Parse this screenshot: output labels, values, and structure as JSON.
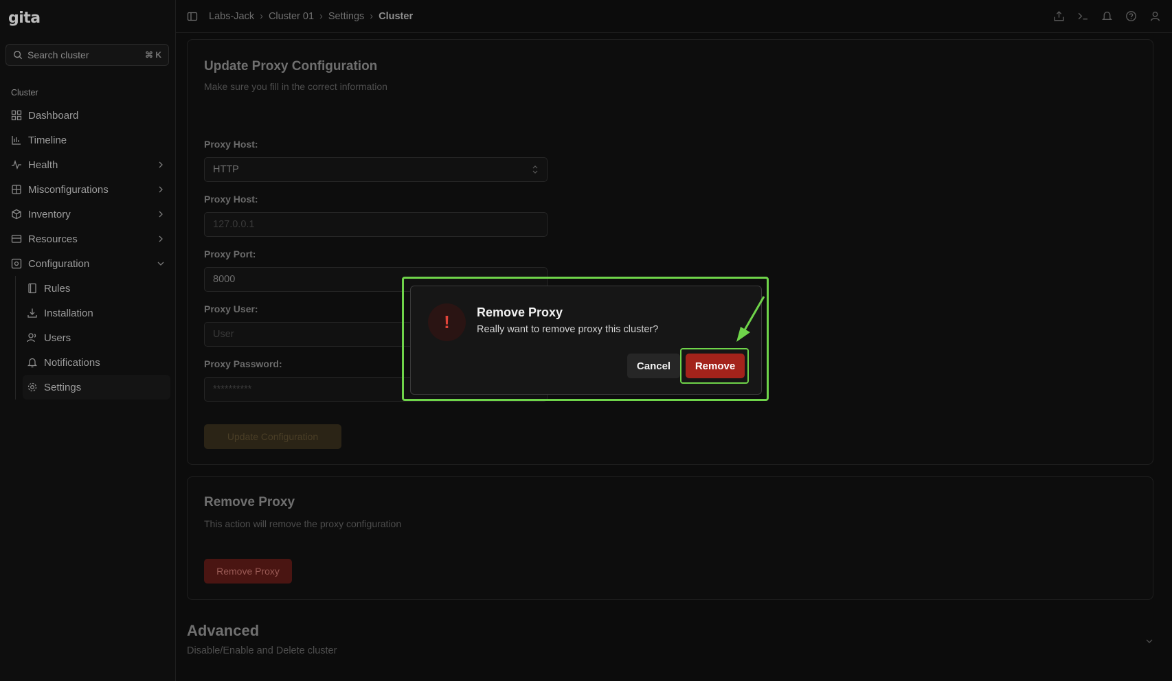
{
  "app": {
    "logo": "gita"
  },
  "sidebar": {
    "search_placeholder": "Search cluster",
    "search_shortcut": "⌘ K",
    "section_label": "Cluster",
    "items": [
      {
        "label": "Dashboard",
        "icon": "grid-icon"
      },
      {
        "label": "Timeline",
        "icon": "chart-icon"
      },
      {
        "label": "Health",
        "icon": "pulse-icon",
        "expandable": true
      },
      {
        "label": "Misconfigurations",
        "icon": "puzzle-icon",
        "expandable": true
      },
      {
        "label": "Inventory",
        "icon": "box-icon",
        "expandable": true
      },
      {
        "label": "Resources",
        "icon": "server-icon",
        "expandable": true
      },
      {
        "label": "Configuration",
        "icon": "config-icon",
        "expanded": true
      }
    ],
    "subitems": [
      {
        "label": "Rules",
        "icon": "book-icon"
      },
      {
        "label": "Installation",
        "icon": "download-icon"
      },
      {
        "label": "Users",
        "icon": "users-icon"
      },
      {
        "label": "Notifications",
        "icon": "bell-icon"
      },
      {
        "label": "Settings",
        "icon": "gear-icon",
        "active": true
      }
    ]
  },
  "breadcrumb": [
    "Labs-Jack",
    "Cluster 01",
    "Settings",
    "Cluster"
  ],
  "proxy_config": {
    "title": "Update Proxy Configuration",
    "subtitle": "Make sure you fill in the correct information",
    "type_label": "Proxy Host:",
    "type_value": "HTTP",
    "host_label": "Proxy Host:",
    "host_placeholder": "127.0.0.1",
    "port_label": "Proxy Port:",
    "port_value": "8000",
    "user_label": "Proxy User:",
    "user_placeholder": "User",
    "password_label": "Proxy Password:",
    "password_placeholder": "**********",
    "submit_label": "Update Configuration"
  },
  "remove_proxy": {
    "title": "Remove Proxy",
    "subtitle": "This action will remove the proxy configuration",
    "button_label": "Remove Proxy"
  },
  "advanced": {
    "title": "Advanced",
    "subtitle": "Disable/Enable and Delete cluster"
  },
  "dialog": {
    "icon_glyph": "!",
    "title": "Remove Proxy",
    "message": "Really want to remove proxy this cluster?",
    "cancel_label": "Cancel",
    "confirm_label": "Remove"
  },
  "colors": {
    "accent_highlight": "#6fd44a",
    "danger": "#a3231b"
  }
}
